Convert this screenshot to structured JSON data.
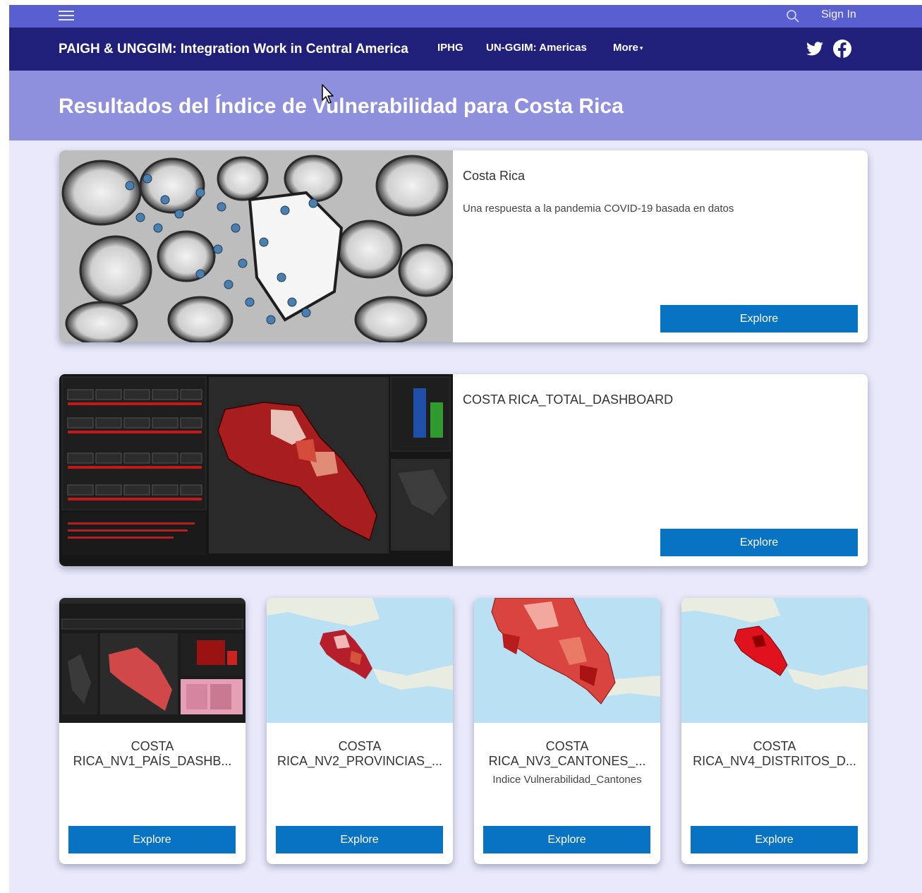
{
  "topbar": {
    "menu_icon": "hamburger-icon",
    "search_icon": "search-icon",
    "signin_label": "Sign In"
  },
  "navbar": {
    "site_title": "PAIGH & UNGGIM: Integration Work in Central America",
    "links": [
      "IPHG",
      "UN-GGIM: Americas",
      "More"
    ],
    "social_icons": [
      "twitter-icon",
      "facebook-icon"
    ]
  },
  "header": {
    "title": "Resultados del Índice de Vulnerabilidad para Costa Rica"
  },
  "cards": [
    {
      "title": "Costa Rica",
      "description": "Una respuesta a la pandemia COVID-19 basada en datos",
      "button": "Explore"
    },
    {
      "title": "COSTA RICA_TOTAL_DASHBOARD",
      "description": "",
      "button": "Explore"
    }
  ],
  "small_cards": [
    {
      "title": "COSTA RICA_NV1_PAÍS_DASHB...",
      "description": "",
      "button": "Explore"
    },
    {
      "title": "COSTA RICA_NV2_PROVINCIAS_...",
      "description": "",
      "button": "Explore"
    },
    {
      "title": "COSTA RICA_NV3_CANTONES_...",
      "description": "Indice Vulnerabilidad_Cantones",
      "button": "Explore"
    },
    {
      "title": "COSTA RICA_NV4_DISTRITOS_D...",
      "description": "",
      "button": "Explore"
    }
  ],
  "colors": {
    "topbar": "#5a5fd0",
    "navbar": "#20207a",
    "header_band": "#8e90dd",
    "page_bg": "#e9e9fb",
    "button": "#0873c3"
  }
}
